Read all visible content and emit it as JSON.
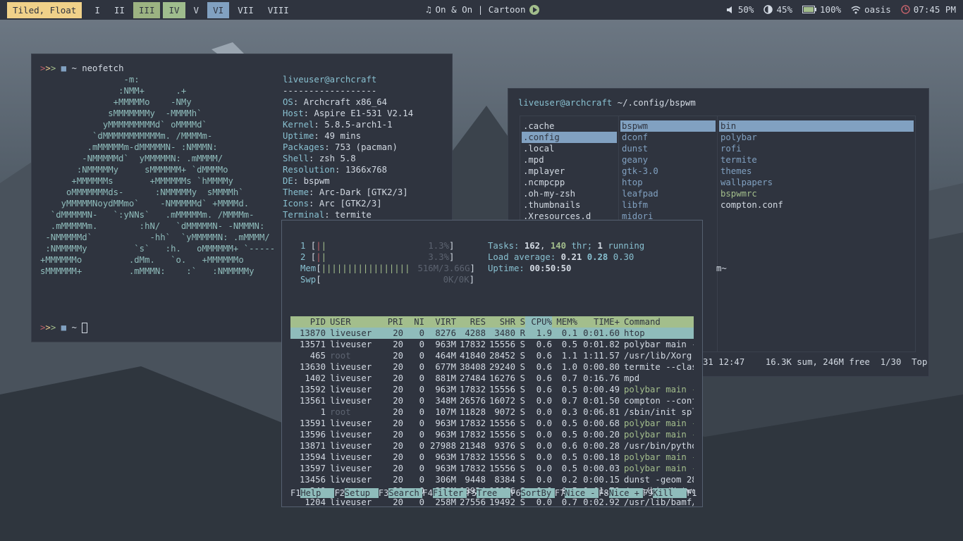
{
  "bar": {
    "mode": "Tiled, Float",
    "workspaces": [
      "I",
      "II",
      "III",
      "IV",
      "V",
      "VI",
      "VII",
      "VIII"
    ],
    "music": "On & On | Cartoon",
    "volume": "50%",
    "brightness": "45%",
    "battery": "100%",
    "wifi": "oasis",
    "clock": "07:45 PM"
  },
  "neofetch": {
    "prompt_cmd": "~ neofetch",
    "prompt_end": "~",
    "ascii": [
      "                -m:",
      "               :NMM+      .+",
      "              +MMMMMo    -NMy",
      "             sMMMMMMMy  -MMMMh`",
      "            yMMMMMMMMMd` oMMMMd`",
      "          `dMMMMMMMMMMMm. /MMMMm-",
      "         .mMMMMMm-dMMMMMN- :NMMMN:",
      "        -NMMMMMd`  yMMMMMN: .mMMMM/",
      "       :NMMMMMy     sMMMMMM+ `dMMMMo",
      "      +MMMMMMs       +MMMMMMs `hMMMMy",
      "     oMMMMMMMds-      :NMMMMMy  sMMMMh`",
      "    yMMMMMNoydMMmo`    -NMMMMMd` +MMMMd.",
      "  `dMMMMMN-   `:yNNs`   .mMMMMMm. /MMMMm-",
      "  .mMMMMMm.        :hN/   `dMMMMMN- -NMMMN:",
      " -NMMMMMd`           -hh`  `yMMMMMN: .mMMMM/",
      " :NMMMMMy         `s`   :h.   oMMMMMM+ `-----",
      "+MMMMMMo         .dMm.   `o.   +MMMMMMo",
      "sMMMMMM+         .mMMMN:    :`   :NMMMMMy"
    ],
    "user": "liveuser@archcraft",
    "sep": "------------------",
    "info": [
      {
        "k": "OS",
        "v": "Archcraft x86_64"
      },
      {
        "k": "Host",
        "v": "Aspire E1-531 V2.14"
      },
      {
        "k": "Kernel",
        "v": "5.8.5-arch1-1"
      },
      {
        "k": "Uptime",
        "v": "49 mins"
      },
      {
        "k": "Packages",
        "v": "753 (pacman)"
      },
      {
        "k": "Shell",
        "v": "zsh 5.8"
      },
      {
        "k": "Resolution",
        "v": "1366x768"
      },
      {
        "k": "DE",
        "v": "bspwm"
      },
      {
        "k": "Theme",
        "v": "Arc-Dark [GTK2/3]"
      },
      {
        "k": "Icons",
        "v": "Arc [GTK2/3]"
      },
      {
        "k": "Terminal",
        "v": "termite"
      }
    ]
  },
  "ranger": {
    "user": "liveuser@archcraft",
    "path": "~/.config/bspwm",
    "col1": [
      ".cache",
      ".config",
      ".local",
      ".mpd",
      ".mplayer",
      ".ncmpcpp",
      ".oh-my-zsh",
      ".thumbnails",
      ".Xresources.d"
    ],
    "col2": [
      "bspwm",
      "dconf",
      "dunst",
      "geany",
      "gtk-3.0",
      "htop",
      "leafpad",
      "libfm",
      "midori"
    ],
    "col3": [
      "bin",
      "polybar",
      "rofi",
      "termite",
      "themes",
      "wallpapers",
      "bspwmrc",
      "compton.conf"
    ],
    "peek": "m~",
    "footer_left": "31 12:47",
    "footer_right": "16.3K sum, 246M free  1/30  Top"
  },
  "htop": {
    "cpu1": {
      "label": "1",
      "pct": "1.3%",
      "level": 0.013
    },
    "cpu2": {
      "label": "2",
      "pct": "3.3%",
      "level": 0.033
    },
    "mem": {
      "label": "Mem",
      "val": "516M/3.66G",
      "level": 0.14
    },
    "swp": {
      "label": "Swp",
      "val": "0K/0K"
    },
    "tasks_label": "Tasks:",
    "tasks": "162",
    "thr": "140",
    "thr_label": "thr;",
    "running": "1",
    "running_label": "running",
    "load_label": "Load average:",
    "load1": "0.21",
    "load5": "0.28",
    "load15": "0.30",
    "uptime_label": "Uptime:",
    "uptime": "00:50:50",
    "headers": [
      "PID",
      "USER",
      "PRI",
      "NI",
      "VIRT",
      "RES",
      "SHR",
      "S",
      "CPU%",
      "MEM%",
      "TIME+",
      "Command"
    ],
    "rows": [
      [
        "13870",
        "liveuser",
        "20",
        "0",
        "8276",
        "4288",
        "3480",
        "R",
        "1.9",
        "0.1",
        "0:01.60",
        "htop"
      ],
      [
        "13571",
        "liveuser",
        "20",
        "0",
        "963M",
        "17832",
        "15556",
        "S",
        "0.6",
        "0.5",
        "0:01.82",
        "polybar main -c"
      ],
      [
        "465",
        "root",
        "20",
        "0",
        "464M",
        "41840",
        "28452",
        "S",
        "0.6",
        "1.1",
        "1:11.57",
        "/usr/lib/Xorg -b"
      ],
      [
        "13630",
        "liveuser",
        "20",
        "0",
        "677M",
        "38408",
        "29240",
        "S",
        "0.6",
        "1.0",
        "0:00.80",
        "termite --class"
      ],
      [
        "1402",
        "liveuser",
        "20",
        "0",
        "881M",
        "27484",
        "16276",
        "S",
        "0.6",
        "0.7",
        "0:16.76",
        "mpd"
      ],
      [
        "13592",
        "liveuser",
        "20",
        "0",
        "963M",
        "17832",
        "15556",
        "S",
        "0.6",
        "0.5",
        "0:00.49",
        "polybar main -c"
      ],
      [
        "13561",
        "liveuser",
        "20",
        "0",
        "348M",
        "26576",
        "16072",
        "S",
        "0.0",
        "0.7",
        "0:01.50",
        "compton --config"
      ],
      [
        "1",
        "root",
        "20",
        "0",
        "107M",
        "11828",
        "9072",
        "S",
        "0.0",
        "0.3",
        "0:06.81",
        "/sbin/init splas"
      ],
      [
        "13591",
        "liveuser",
        "20",
        "0",
        "963M",
        "17832",
        "15556",
        "S",
        "0.0",
        "0.5",
        "0:00.68",
        "polybar main -c"
      ],
      [
        "13596",
        "liveuser",
        "20",
        "0",
        "963M",
        "17832",
        "15556",
        "S",
        "0.0",
        "0.5",
        "0:00.20",
        "polybar main -c"
      ],
      [
        "13871",
        "liveuser",
        "20",
        "0",
        "27988",
        "21348",
        "9376",
        "S",
        "0.0",
        "0.6",
        "0:00.28",
        "/usr/bin/python"
      ],
      [
        "13594",
        "liveuser",
        "20",
        "0",
        "963M",
        "17832",
        "15556",
        "S",
        "0.0",
        "0.5",
        "0:00.18",
        "polybar main -c"
      ],
      [
        "13597",
        "liveuser",
        "20",
        "0",
        "963M",
        "17832",
        "15556",
        "S",
        "0.0",
        "0.5",
        "0:00.03",
        "polybar main -c"
      ],
      [
        "13456",
        "liveuser",
        "20",
        "0",
        "306M",
        "9448",
        "8384",
        "S",
        "0.0",
        "0.2",
        "0:00.15",
        "dunst -geom 280x"
      ],
      [
        "349",
        "root",
        "20",
        "0",
        "250M",
        "18924",
        "16136",
        "S",
        "0.0",
        "0.5",
        "0:01.70",
        "/usr/bin/Network"
      ],
      [
        "1204",
        "liveuser",
        "20",
        "0",
        "258M",
        "27556",
        "19492",
        "S",
        "0.0",
        "0.7",
        "0:02.92",
        "/usr/lib/bamf/ba"
      ]
    ],
    "fkeys": [
      {
        "k": "F1",
        "v": "Help"
      },
      {
        "k": "F2",
        "v": "Setup"
      },
      {
        "k": "F3",
        "v": "Search"
      },
      {
        "k": "F4",
        "v": "Filter"
      },
      {
        "k": "F5",
        "v": "Tree"
      },
      {
        "k": "F6",
        "v": "SortBy"
      },
      {
        "k": "F7",
        "v": "Nice -"
      },
      {
        "k": "F8",
        "v": "Nice +"
      },
      {
        "k": "F9",
        "v": "Kill"
      },
      {
        "k": "F1",
        "v": ""
      }
    ]
  }
}
